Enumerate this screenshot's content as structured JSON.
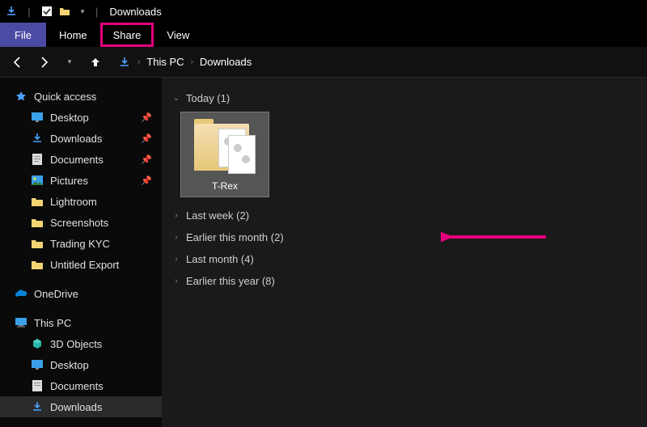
{
  "window": {
    "title": "Downloads"
  },
  "ribbon": {
    "file": "File",
    "tabs": [
      "Home",
      "Share",
      "View"
    ],
    "highlighted_index": 1
  },
  "nav": {
    "crumbs": [
      "This PC",
      "Downloads"
    ]
  },
  "sidebar": {
    "quick_access": "Quick access",
    "quick_items": [
      {
        "label": "Desktop",
        "pinned": true,
        "icon": "desktop"
      },
      {
        "label": "Downloads",
        "pinned": true,
        "icon": "downloads"
      },
      {
        "label": "Documents",
        "pinned": true,
        "icon": "documents"
      },
      {
        "label": "Pictures",
        "pinned": true,
        "icon": "pictures"
      },
      {
        "label": "Lightroom",
        "pinned": false,
        "icon": "folder"
      },
      {
        "label": "Screenshots",
        "pinned": false,
        "icon": "folder"
      },
      {
        "label": "Trading KYC",
        "pinned": false,
        "icon": "folder"
      },
      {
        "label": "Untitled Export",
        "pinned": false,
        "icon": "folder"
      }
    ],
    "onedrive": "OneDrive",
    "this_pc": "This PC",
    "pc_items": [
      {
        "label": "3D Objects",
        "icon": "3d"
      },
      {
        "label": "Desktop",
        "icon": "desktop"
      },
      {
        "label": "Documents",
        "icon": "documents"
      },
      {
        "label": "Downloads",
        "icon": "downloads",
        "selected": true
      }
    ]
  },
  "content": {
    "groups": [
      {
        "label": "Today (1)",
        "expanded": true,
        "items": [
          {
            "label": "T-Rex"
          }
        ]
      },
      {
        "label": "Last week (2)",
        "expanded": false
      },
      {
        "label": "Earlier this month (2)",
        "expanded": false
      },
      {
        "label": "Last month (4)",
        "expanded": false
      },
      {
        "label": "Earlier this year (8)",
        "expanded": false
      }
    ]
  },
  "colors": {
    "highlight": "#e6007e",
    "file_tab": "#4b4ba3"
  }
}
